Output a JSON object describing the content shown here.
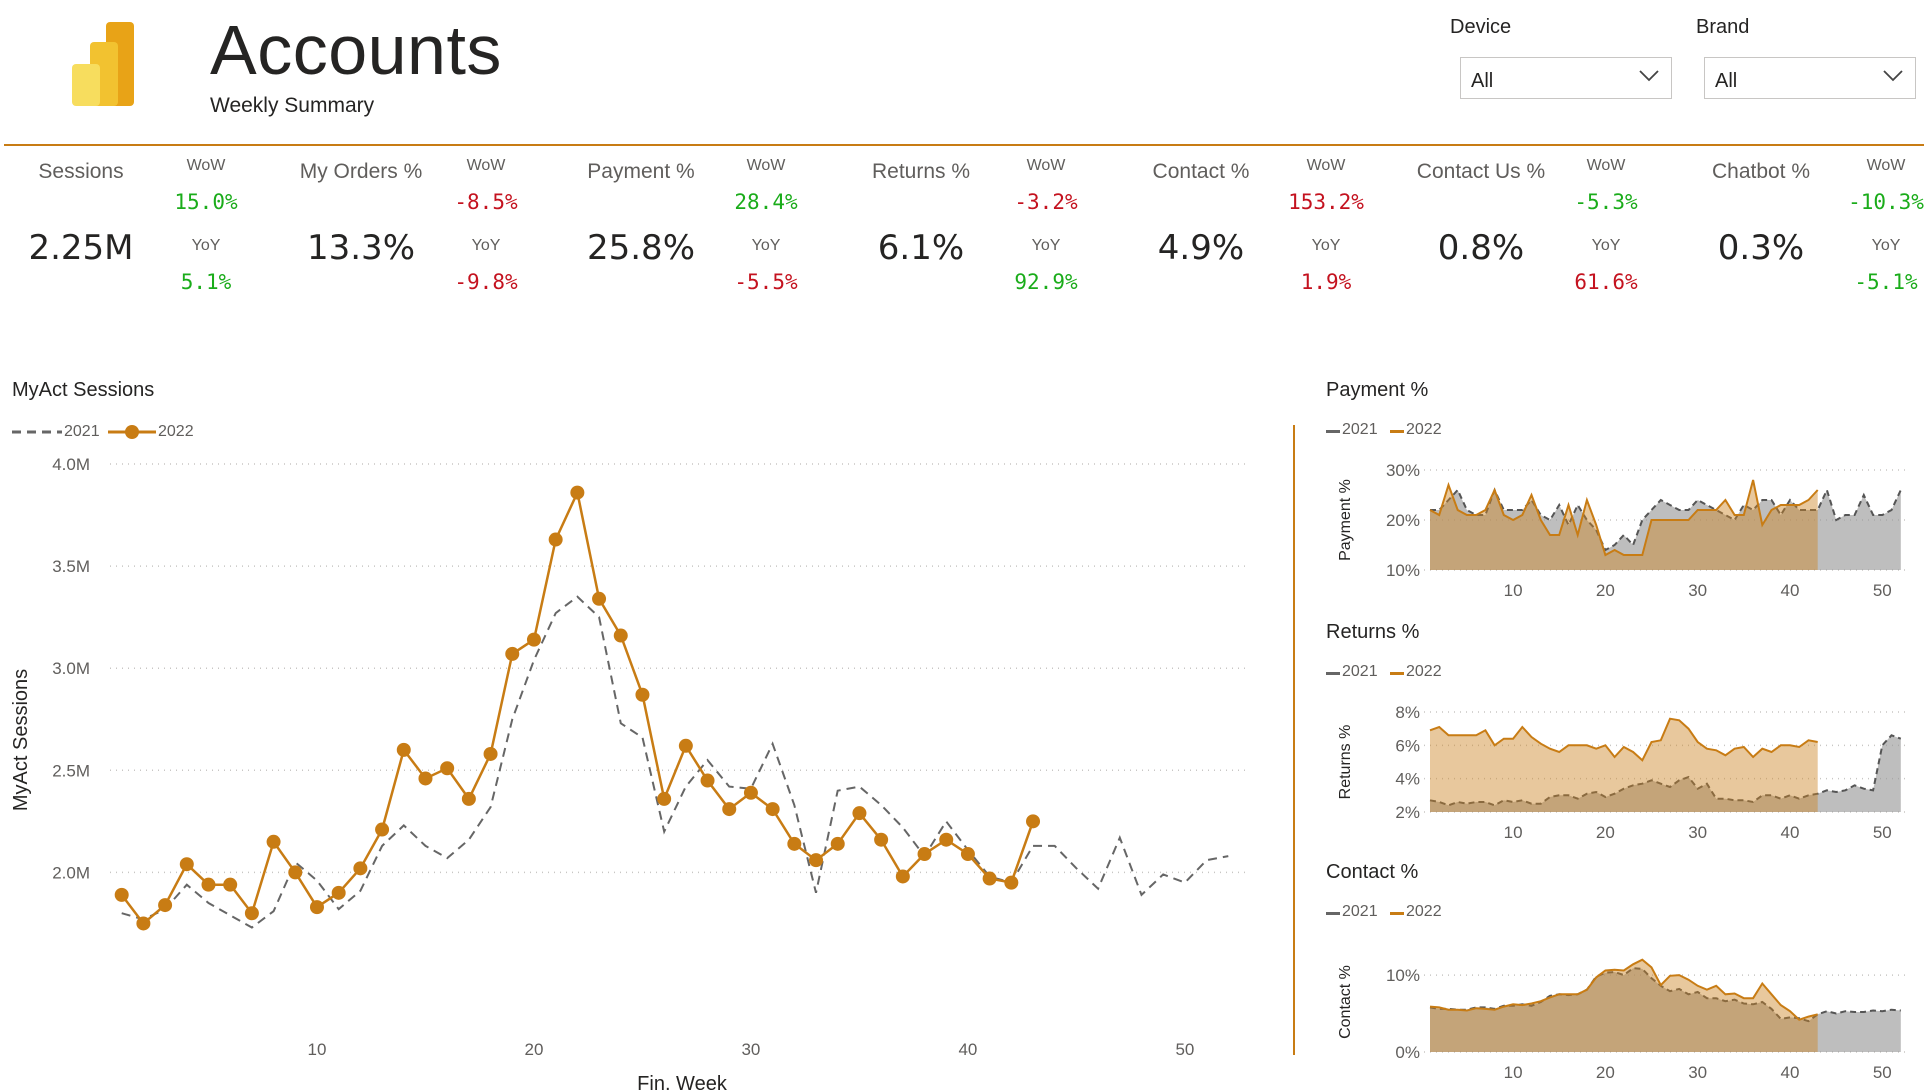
{
  "header": {
    "title": "Accounts",
    "subtitle": "Weekly Summary"
  },
  "filters": [
    {
      "label": "Device",
      "value": "All"
    },
    {
      "label": "Brand",
      "value": "All"
    }
  ],
  "colors": {
    "accent": "#c87c14",
    "positive": "#1aac1a",
    "negative": "#c4121f",
    "series2021": "#666666"
  },
  "kpis": [
    {
      "name": "Sessions",
      "value": "2.25M",
      "wow_label": "WoW",
      "wow": "15.0%",
      "wow_dir": "pos",
      "yoy_label": "YoY",
      "yoy": "5.1%",
      "yoy_dir": "pos"
    },
    {
      "name": "My Orders %",
      "value": "13.3%",
      "wow_label": "WoW",
      "wow": "-8.5%",
      "wow_dir": "neg",
      "yoy_label": "YoY",
      "yoy": "-9.8%",
      "yoy_dir": "neg"
    },
    {
      "name": "Payment %",
      "value": "25.8%",
      "wow_label": "WoW",
      "wow": "28.4%",
      "wow_dir": "pos",
      "yoy_label": "YoY",
      "yoy": "-5.5%",
      "yoy_dir": "neg"
    },
    {
      "name": "Returns %",
      "value": "6.1%",
      "wow_label": "WoW",
      "wow": "-3.2%",
      "wow_dir": "neg",
      "yoy_label": "YoY",
      "yoy": "92.9%",
      "yoy_dir": "pos"
    },
    {
      "name": "Contact %",
      "value": "4.9%",
      "wow_label": "WoW",
      "wow": "153.2%",
      "wow_dir": "neg",
      "yoy_label": "YoY",
      "yoy": "1.9%",
      "yoy_dir": "neg"
    },
    {
      "name": "Contact Us %",
      "value": "0.8%",
      "wow_label": "WoW",
      "wow": "-5.3%",
      "wow_dir": "pos",
      "yoy_label": "YoY",
      "yoy": "61.6%",
      "yoy_dir": "neg"
    },
    {
      "name": "Chatbot %",
      "value": "0.3%",
      "wow_label": "WoW",
      "wow": "-10.3%",
      "wow_dir": "pos",
      "yoy_label": "YoY",
      "yoy": "-5.1%",
      "yoy_dir": "pos"
    }
  ],
  "chart_data": [
    {
      "type": "line",
      "title": "MyAct Sessions",
      "xlabel": "Fin. Week",
      "ylabel": "MyAct Sessions",
      "xticks": [
        10,
        20,
        30,
        40,
        50
      ],
      "yticks": [
        "2.0M",
        "2.5M",
        "3.0M",
        "3.5M",
        "4.0M"
      ],
      "ytick_values": [
        2.0,
        2.5,
        3.0,
        3.5,
        4.0
      ],
      "xlim": [
        0,
        53
      ],
      "ylim": [
        1.62,
        4.0
      ],
      "grid": true,
      "legend_position": "top-left",
      "series": [
        {
          "name": "2021",
          "style": "dashed",
          "color": "#666666",
          "x": [
            1,
            2,
            3,
            4,
            5,
            6,
            7,
            8,
            9,
            10,
            11,
            12,
            13,
            14,
            15,
            16,
            17,
            18,
            19,
            20,
            21,
            22,
            23,
            24,
            25,
            26,
            27,
            28,
            29,
            30,
            31,
            32,
            33,
            34,
            35,
            36,
            37,
            38,
            39,
            40,
            41,
            42,
            43,
            44,
            45,
            46,
            47,
            48,
            49,
            50,
            51,
            52
          ],
          "values": [
            1.8,
            1.77,
            1.82,
            1.94,
            1.85,
            1.79,
            1.73,
            1.81,
            2.05,
            1.96,
            1.82,
            1.91,
            2.13,
            2.23,
            2.13,
            2.07,
            2.16,
            2.32,
            2.75,
            3.04,
            3.27,
            3.35,
            3.25,
            2.73,
            2.66,
            2.2,
            2.42,
            2.55,
            2.42,
            2.41,
            2.63,
            2.33,
            1.9,
            2.4,
            2.42,
            2.33,
            2.22,
            2.08,
            2.25,
            2.11,
            1.98,
            1.95,
            2.13,
            2.13,
            2.02,
            1.92,
            2.17,
            1.89,
            1.99,
            1.95,
            2.06,
            2.08
          ]
        },
        {
          "name": "2022",
          "style": "solid-marker",
          "color": "#c87c14",
          "x": [
            1,
            2,
            3,
            4,
            5,
            6,
            7,
            8,
            9,
            10,
            11,
            12,
            13,
            14,
            15,
            16,
            17,
            18,
            19,
            20,
            21,
            22,
            23,
            24,
            25,
            26,
            27,
            28,
            29,
            30,
            31,
            32,
            33,
            34,
            35,
            36,
            37,
            38,
            39,
            40,
            41,
            42,
            43
          ],
          "values": [
            1.89,
            1.75,
            1.84,
            2.04,
            1.94,
            1.94,
            1.8,
            2.15,
            2.0,
            1.83,
            1.9,
            2.02,
            2.21,
            2.6,
            2.46,
            2.51,
            2.36,
            2.58,
            3.07,
            3.14,
            3.63,
            3.86,
            3.34,
            3.16,
            2.87,
            2.36,
            2.62,
            2.45,
            2.31,
            2.39,
            2.31,
            2.14,
            2.06,
            2.14,
            2.29,
            2.16,
            1.98,
            2.09,
            2.16,
            2.09,
            1.97,
            1.95,
            2.25
          ]
        }
      ]
    },
    {
      "type": "area",
      "title": "Payment %",
      "ylabel": "Payment %",
      "xticks": [
        10,
        20,
        30,
        40,
        50
      ],
      "yticks": [
        "10%",
        "20%",
        "30%"
      ],
      "ytick_values": [
        10,
        20,
        30
      ],
      "xlim": [
        1,
        53
      ],
      "ylim": [
        10,
        30
      ],
      "grid": true,
      "legend_position": "top-left",
      "series": [
        {
          "name": "2021",
          "x": [
            1,
            2,
            3,
            4,
            5,
            6,
            7,
            8,
            9,
            10,
            11,
            12,
            13,
            14,
            15,
            16,
            17,
            18,
            19,
            20,
            21,
            22,
            23,
            24,
            25,
            26,
            27,
            28,
            29,
            30,
            31,
            32,
            33,
            34,
            35,
            36,
            37,
            38,
            39,
            40,
            41,
            42,
            43,
            44,
            45,
            46,
            47,
            48,
            49,
            50,
            51,
            52
          ],
          "values": [
            22,
            22,
            24,
            26,
            22,
            21,
            21,
            26,
            22,
            22,
            22,
            24,
            21,
            20,
            23,
            19,
            23,
            20,
            18,
            14,
            15,
            17,
            15,
            20,
            22,
            24,
            23,
            22,
            22,
            24,
            23,
            22,
            21,
            20,
            23,
            22,
            24,
            24,
            21,
            24,
            22,
            22,
            22,
            26,
            20,
            21,
            21,
            25,
            21,
            21,
            22,
            26
          ]
        },
        {
          "name": "2022",
          "x": [
            1,
            2,
            3,
            4,
            5,
            6,
            7,
            8,
            9,
            10,
            11,
            12,
            13,
            14,
            15,
            16,
            17,
            18,
            19,
            20,
            21,
            22,
            23,
            24,
            25,
            26,
            27,
            28,
            29,
            30,
            31,
            32,
            33,
            34,
            35,
            36,
            37,
            38,
            39,
            40,
            41,
            42,
            43
          ],
          "values": [
            22,
            21,
            27,
            22,
            21,
            21,
            22,
            26,
            21,
            20,
            21,
            25,
            20,
            17,
            17,
            23,
            17,
            24,
            19,
            13,
            14,
            13,
            13,
            13,
            20,
            20,
            20,
            20,
            20,
            22,
            22,
            22,
            24,
            21,
            21,
            28,
            19,
            22,
            23,
            23,
            23,
            24,
            26
          ]
        }
      ]
    },
    {
      "type": "area",
      "title": "Returns %",
      "ylabel": "Returns %",
      "xticks": [
        10,
        20,
        30,
        40,
        50
      ],
      "yticks": [
        "2%",
        "4%",
        "6%",
        "8%"
      ],
      "ytick_values": [
        2,
        4,
        6,
        8
      ],
      "xlim": [
        1,
        53
      ],
      "ylim": [
        2,
        8
      ],
      "grid": true,
      "legend_position": "top-left",
      "series": [
        {
          "name": "2021",
          "x": [
            1,
            2,
            3,
            4,
            5,
            6,
            7,
            8,
            9,
            10,
            11,
            12,
            13,
            14,
            15,
            16,
            17,
            18,
            19,
            20,
            21,
            22,
            23,
            24,
            25,
            26,
            27,
            28,
            29,
            30,
            31,
            32,
            33,
            34,
            35,
            36,
            37,
            38,
            39,
            40,
            41,
            42,
            43,
            44,
            45,
            46,
            47,
            48,
            49,
            50,
            51,
            52
          ],
          "values": [
            2.7,
            2.6,
            2.4,
            2.6,
            2.5,
            2.6,
            2.6,
            2.4,
            2.7,
            2.6,
            2.7,
            2.5,
            2.5,
            2.9,
            3.0,
            3.0,
            2.8,
            3.1,
            3.2,
            2.9,
            3.1,
            3.4,
            3.6,
            3.7,
            3.9,
            3.7,
            3.5,
            3.9,
            4.1,
            3.4,
            3.7,
            2.8,
            2.8,
            2.7,
            2.7,
            2.6,
            3.0,
            3.0,
            2.8,
            3.0,
            2.8,
            3.0,
            3.1,
            3.3,
            3.2,
            3.3,
            3.6,
            3.4,
            3.3,
            6.0,
            6.6,
            6.4
          ]
        },
        {
          "name": "2022",
          "x": [
            1,
            2,
            3,
            4,
            5,
            6,
            7,
            8,
            9,
            10,
            11,
            12,
            13,
            14,
            15,
            16,
            17,
            18,
            19,
            20,
            21,
            22,
            23,
            24,
            25,
            26,
            27,
            28,
            29,
            30,
            31,
            32,
            33,
            34,
            35,
            36,
            37,
            38,
            39,
            40,
            41,
            42,
            43
          ],
          "values": [
            6.9,
            7.1,
            6.6,
            6.6,
            6.6,
            6.6,
            6.9,
            6.0,
            6.4,
            6.4,
            7.1,
            6.5,
            6.1,
            5.8,
            5.6,
            6.0,
            6.0,
            6.0,
            5.8,
            6.0,
            5.3,
            5.9,
            5.6,
            5.1,
            6.2,
            6.3,
            7.6,
            7.5,
            7.0,
            6.2,
            5.8,
            5.7,
            5.4,
            5.8,
            5.9,
            5.3,
            5.8,
            5.6,
            6.0,
            6.0,
            5.9,
            6.3,
            6.2
          ]
        }
      ]
    },
    {
      "type": "area",
      "title": "Contact %",
      "ylabel": "Contact %",
      "xticks": [
        10,
        20,
        30,
        40,
        50
      ],
      "yticks": [
        "0%",
        "10%"
      ],
      "ytick_values": [
        0,
        10
      ],
      "xlim": [
        1,
        53
      ],
      "ylim": [
        0,
        13
      ],
      "grid": true,
      "legend_position": "top-left",
      "series": [
        {
          "name": "2021",
          "x": [
            1,
            2,
            3,
            4,
            5,
            6,
            7,
            8,
            9,
            10,
            11,
            12,
            13,
            14,
            15,
            16,
            17,
            18,
            19,
            20,
            21,
            22,
            23,
            24,
            25,
            26,
            27,
            28,
            29,
            30,
            31,
            32,
            33,
            34,
            35,
            36,
            37,
            38,
            39,
            40,
            41,
            42,
            43,
            44,
            45,
            46,
            47,
            48,
            49,
            50,
            51,
            52
          ],
          "values": [
            5.8,
            5.6,
            5.6,
            5.5,
            5.5,
            5.8,
            5.8,
            5.6,
            6.0,
            6.0,
            6.2,
            6.0,
            6.5,
            7.3,
            7.5,
            7.4,
            7.5,
            8.1,
            9.8,
            10.3,
            10.4,
            10.0,
            10.9,
            10.8,
            9.6,
            8.6,
            7.9,
            8.2,
            7.5,
            7.8,
            7.0,
            7.0,
            6.6,
            6.8,
            6.3,
            6.2,
            6.5,
            5.6,
            4.3,
            4.5,
            4.4,
            4.0,
            4.9,
            5.3,
            5.0,
            5.3,
            5.2,
            5.2,
            5.4,
            5.3,
            5.5,
            5.4
          ]
        },
        {
          "name": "2022",
          "x": [
            1,
            2,
            3,
            4,
            5,
            6,
            7,
            8,
            9,
            10,
            11,
            12,
            13,
            14,
            15,
            16,
            17,
            18,
            19,
            20,
            21,
            22,
            23,
            24,
            25,
            26,
            27,
            28,
            29,
            30,
            31,
            32,
            33,
            34,
            35,
            36,
            37,
            38,
            39,
            40,
            41,
            42,
            43
          ],
          "values": [
            5.9,
            5.8,
            5.5,
            5.5,
            5.4,
            5.7,
            5.6,
            5.5,
            5.9,
            6.2,
            6.1,
            6.3,
            6.6,
            7.1,
            7.5,
            7.5,
            7.5,
            8.1,
            9.7,
            10.6,
            10.7,
            10.6,
            11.4,
            12.0,
            11.0,
            8.7,
            9.9,
            10.0,
            9.4,
            8.6,
            8.1,
            8.6,
            7.5,
            7.6,
            7.0,
            7.0,
            8.9,
            7.5,
            6.1,
            5.3,
            4.2,
            4.6,
            4.9
          ]
        }
      ]
    }
  ]
}
